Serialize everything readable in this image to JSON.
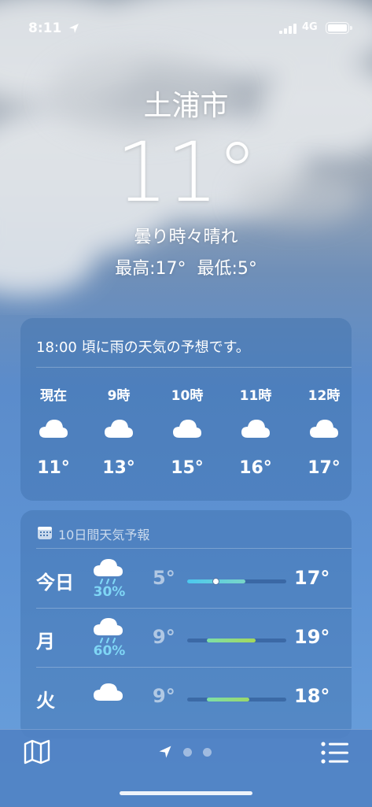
{
  "status_bar": {
    "time": "8:11",
    "network": "4G",
    "location_icon": "location-arrow-icon",
    "signal_icon": "cellular-signal-icon",
    "battery_icon": "battery-icon"
  },
  "hero": {
    "city": "土浦市",
    "temperature": "11°",
    "condition": "曇り時々晴れ",
    "high_low": "最高:17°  最低:5°"
  },
  "hourly": {
    "banner": "18:00 頃に雨の天気の予想です。",
    "items": [
      {
        "label": "現在",
        "icon": "cloud-icon",
        "temp": "11°"
      },
      {
        "label": "9時",
        "icon": "cloud-icon",
        "temp": "13°"
      },
      {
        "label": "10時",
        "icon": "cloud-icon",
        "temp": "15°"
      },
      {
        "label": "11時",
        "icon": "cloud-icon",
        "temp": "16°"
      },
      {
        "label": "12時",
        "icon": "cloud-icon",
        "temp": "17°"
      }
    ]
  },
  "forecast": {
    "title": "10日間天気予報",
    "days": [
      {
        "day": "今日",
        "icon": "cloud-rain-icon",
        "precip": "30%",
        "low": "5°",
        "high": "17°",
        "current_marker": true,
        "range_colors": [
          "#4cc8ef",
          "#79d6c8"
        ]
      },
      {
        "day": "月",
        "icon": "cloud-rain-icon",
        "precip": "60%",
        "low": "9°",
        "high": "19°",
        "current_marker": false,
        "range_colors": [
          "#7ddfa8",
          "#a5d85a"
        ]
      },
      {
        "day": "火",
        "icon": "cloud-icon",
        "precip": "",
        "low": "9°",
        "high": "18°",
        "current_marker": false,
        "range_colors": [
          "#7ddfa8",
          "#9bd86a"
        ]
      }
    ]
  },
  "bottom_bar": {
    "map_icon": "map-icon",
    "location_icon": "location-arrow-icon",
    "list_icon": "list-icon",
    "pages": 3,
    "current_page": 1
  }
}
